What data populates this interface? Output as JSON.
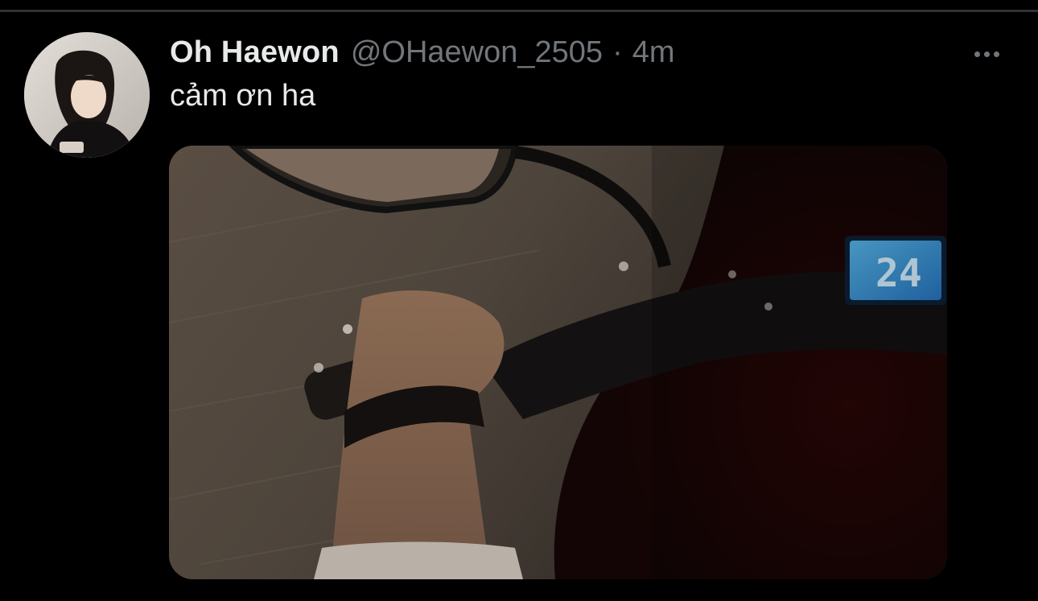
{
  "tweet": {
    "author": {
      "display_name": "Oh Haewon",
      "handle": "@OHaewon_2505"
    },
    "separator": "·",
    "timestamp": "4m",
    "text": "cảm ơn ha",
    "media": {
      "type": "photo",
      "speedometer_reading": "24"
    }
  },
  "icons": {
    "more": "more-horizontal-icon"
  },
  "colors": {
    "background": "#000000",
    "primary_text": "#e7e9ea",
    "secondary_text": "#71767b",
    "divider": "#2f3336",
    "display_glow": "#3fb0ff"
  }
}
